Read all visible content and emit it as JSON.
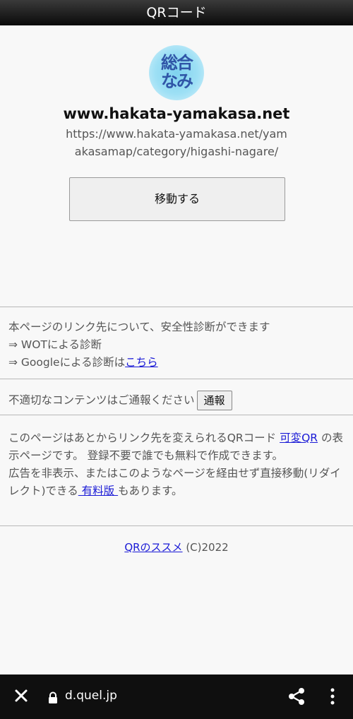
{
  "header": {
    "title": "QRコード"
  },
  "logo": {
    "text": "総合\nなみ"
  },
  "site": {
    "title": "www.hakata-yamakasa.net",
    "url": "https://www.hakata-yamakasa.net/yamakasamap/category/higashi-nagare/"
  },
  "go_button": {
    "label": "移動する"
  },
  "safety": {
    "line1": "本ページのリンク先について、安全性診断ができます",
    "line2": "⇒ WOTによる診断",
    "line3_prefix": "⇒ Googleによる診断は",
    "line3_link": "こちら"
  },
  "report": {
    "text": "不適切なコンテンツはご通報ください",
    "button": "通報"
  },
  "info": {
    "part1": "このページはあとからリンク先を変えられるQRコード ",
    "link1": "可変QR",
    "part2": " の表示ページです。 登録不要で誰でも無料で作成できます。",
    "part3": "広告を非表示、またはこのようなページを経由せず直接移動(リダイレクト)できる",
    "link2": " 有料版 ",
    "part4": "もあります。"
  },
  "footer": {
    "link": "QRのススメ",
    "copyright": " (C)2022"
  },
  "browser": {
    "domain": "d.quel.jp"
  }
}
